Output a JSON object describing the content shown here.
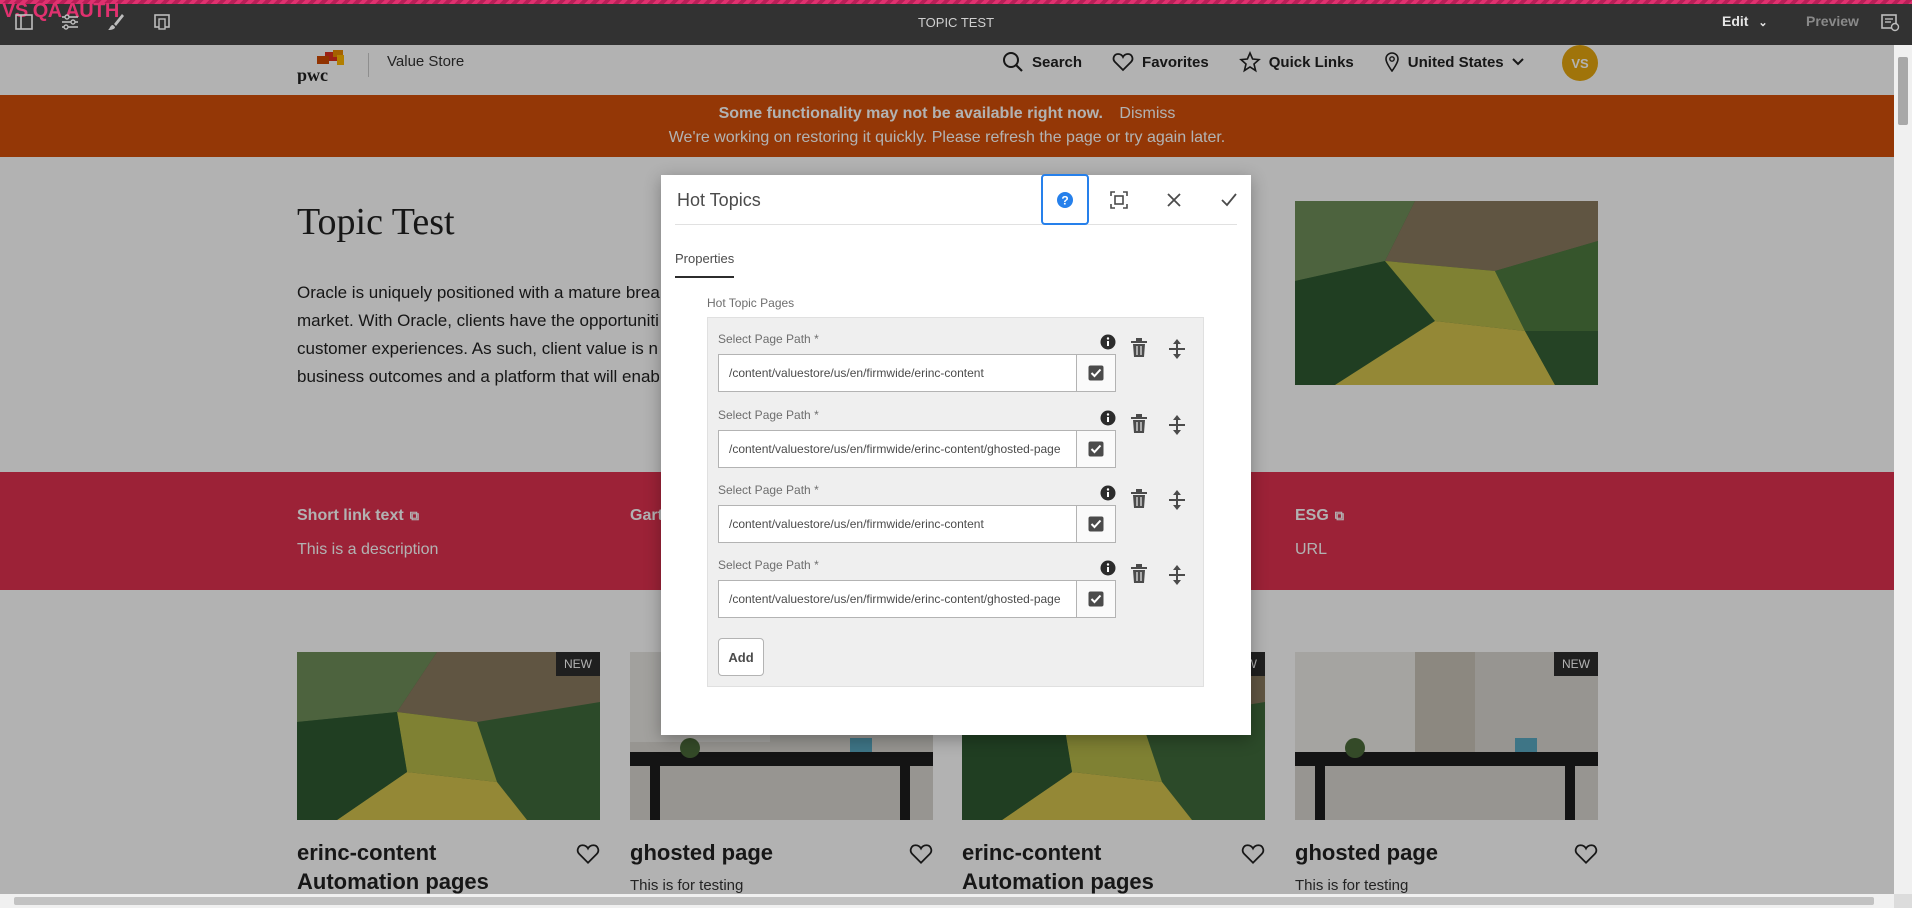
{
  "aem": {
    "env_label": "VS QA AUTH",
    "page_title": "TOPIC TEST",
    "edit_label": "Edit",
    "preview_label": "Preview"
  },
  "header": {
    "site_name": "Value Store",
    "logo_text": "pwc",
    "search_label": "Search",
    "favorites_label": "Favorites",
    "quicklinks_label": "Quick Links",
    "region_label": "United States",
    "avatar_initials": "VS"
  },
  "alert": {
    "title": "Some functionality may not be available right now.",
    "dismiss": "Dismiss",
    "message": "We're working on restoring it quickly. Please refresh the page or try again later."
  },
  "hero": {
    "title": "Topic Test",
    "lines": [
      "Oracle is uniquely positioned with a mature brea",
      "market. With Oracle, clients have the opportuniti",
      "customer experiences. As such, client value is n",
      "business outcomes and a platform that will enab"
    ]
  },
  "links": [
    {
      "title": "Short link text",
      "desc": "This is a description"
    },
    {
      "title": "Gart",
      "desc": ""
    },
    {
      "title": "ESG",
      "desc": "URL"
    }
  ],
  "cards": [
    {
      "title": "erinc-content Automation pages",
      "badge": "NEW",
      "desc": ""
    },
    {
      "title": "ghosted page",
      "badge": "",
      "desc": "This is for testing"
    },
    {
      "title": "erinc-content Automation pages",
      "badge": "W",
      "desc": ""
    },
    {
      "title": "ghosted page",
      "badge": "NEW",
      "desc": "This is for testing"
    }
  ],
  "dialog": {
    "title": "Hot Topics",
    "tab": "Properties",
    "section_label": "Hot Topic Pages",
    "field_label": "Select Page Path *",
    "items": [
      {
        "value": "/content/valuestore/us/en/firmwide/erinc-content"
      },
      {
        "value": "/content/valuestore/us/en/firmwide/erinc-content/ghosted-page"
      },
      {
        "value": "/content/valuestore/us/en/firmwide/erinc-content"
      },
      {
        "value": "/content/valuestore/us/en/firmwide/erinc-content/ghosted-page"
      }
    ],
    "add_label": "Add"
  },
  "colors": {
    "alert_bg": "#d4500a",
    "band_bg": "#e0314f",
    "avatar_bg": "#e5a70f",
    "help_border": "#2680eb",
    "env_label": "#e0316f"
  }
}
